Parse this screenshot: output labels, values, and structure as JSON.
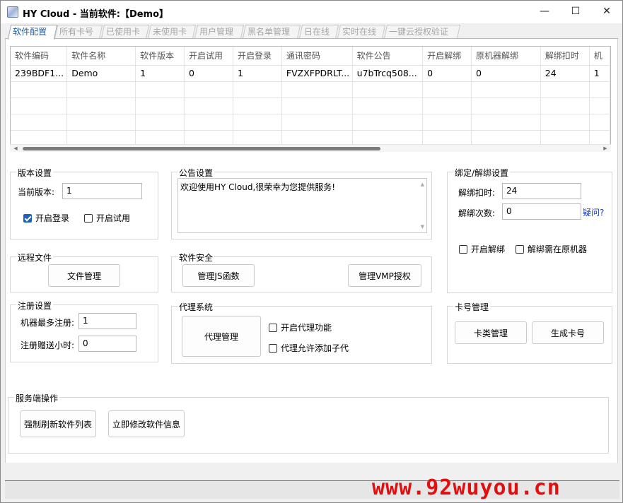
{
  "window": {
    "title": "HY Cloud - 当前软件:【Demo】",
    "controls": {
      "minimize": "—",
      "maximize": "☐",
      "close": "✕"
    }
  },
  "tabs": [
    {
      "label": "软件配置",
      "active": true
    },
    {
      "label": "所有卡号",
      "active": false
    },
    {
      "label": "已使用卡",
      "active": false
    },
    {
      "label": "未使用卡",
      "active": false
    },
    {
      "label": "用户管理",
      "active": false
    },
    {
      "label": "黑名单管理",
      "active": false
    },
    {
      "label": "日在线",
      "active": false
    },
    {
      "label": "实时在线",
      "active": false
    },
    {
      "label": "一键云授权验证",
      "active": false
    }
  ],
  "grid": {
    "columns": [
      "软件编码",
      "软件名称",
      "软件版本",
      "开启试用",
      "开启登录",
      "通讯密码",
      "软件公告",
      "开启解绑",
      "原机器解绑",
      "解绑扣时",
      "机"
    ],
    "rows": [
      [
        "239BDF1...",
        "Demo",
        "1",
        "0",
        "1",
        "FVZXFPDRLT...",
        "u7bTrcq508...",
        "0",
        "0",
        "24",
        "1"
      ]
    ]
  },
  "version": {
    "title": "版本设置",
    "current_label": "当前版本:",
    "current_value": "1",
    "login_label": "开启登录",
    "login_checked": true,
    "trial_label": "开启试用",
    "trial_checked": false
  },
  "notice": {
    "title": "公告设置",
    "text": "欢迎使用HY Cloud,很荣幸为您提供服务!"
  },
  "bind": {
    "title": "绑定/解绑设置",
    "deduct_label": "解绑扣时:",
    "deduct_value": "24",
    "count_label": "解绑次数:",
    "count_value": "0",
    "help_link": "疑问?",
    "unbind_label": "开启解绑",
    "unbind_checked": false,
    "origin_label": "解绑需在原机器",
    "origin_checked": false
  },
  "remote": {
    "title": "远程文件",
    "file_button": "文件管理"
  },
  "security": {
    "title": "软件安全",
    "js_button": "管理JS函数",
    "vmp_button": "管理VMP授权"
  },
  "register": {
    "title": "注册设置",
    "max_label": "机器最多注册:",
    "max_value": "1",
    "gift_label": "注册赠送小时:",
    "gift_value": "0"
  },
  "proxy": {
    "title": "代理系统",
    "manage_button": "代理管理",
    "enable_label": "开启代理功能",
    "enable_checked": false,
    "sub_label": "代理允许添加子代",
    "sub_checked": false
  },
  "cards": {
    "title": "卡号管理",
    "type_button": "卡类管理",
    "gen_button": "生成卡号"
  },
  "server": {
    "title": "服务端操作",
    "refresh_button": "强制刷新软件列表",
    "modify_button": "立即修改软件信息"
  },
  "watermark": "www.92wuyou.cn"
}
